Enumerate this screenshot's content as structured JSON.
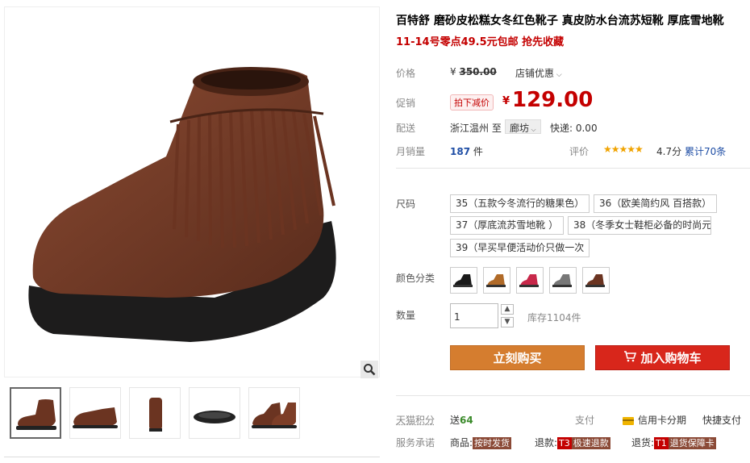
{
  "product": {
    "title": "百特舒 磨砂皮松糕女冬红色靴子 真皮防水台流苏短靴 厚底雪地靴",
    "promo": "11-14号零点49.5元包邮 抢先收藏"
  },
  "price": {
    "label": "价格",
    "currency": "¥",
    "original": "350.00",
    "store_discount": "店铺优惠"
  },
  "promotion": {
    "label": "促销",
    "tag": "拍下减价",
    "currency": "¥",
    "price": "129.00"
  },
  "shipping": {
    "label": "配送",
    "from": "浙江温州",
    "to_word": "至",
    "to": "廊坊",
    "fee": "快递: 0.00"
  },
  "sales": {
    "label": "月销量",
    "count": "187",
    "unit": "件",
    "rating_label": "评价",
    "stars": "★★★★★",
    "score": "4.7分",
    "reviews": "累计70条"
  },
  "size": {
    "label": "尺码",
    "options": [
      "35（五款今冬流行的糖果色）",
      "36（欧美简约风 百搭款）",
      "37（厚底流苏雪地靴 ）",
      "38（冬季女士鞋柜必备的时尚元",
      "39（早买早便活动价只做一次"
    ]
  },
  "color": {
    "label": "颜色分类"
  },
  "quantity": {
    "label": "数量",
    "value": "1",
    "up": "▲",
    "down": "▼",
    "stock": "库存1104件"
  },
  "actions": {
    "buy": "立刻购买",
    "cart": "加入购物车"
  },
  "points": {
    "label": "天猫积分",
    "send": "送",
    "value": "64",
    "pay": "支付",
    "credit": "信用卡分期",
    "fast_pay": "快捷支付"
  },
  "service": {
    "label": "服务承诺",
    "goods": "商品:",
    "goods_badge": "按时发货",
    "refund": "退款:",
    "refund_t": "T3",
    "refund_badge": "极速退款",
    "return": "退货:",
    "return_t": "T1",
    "return_badge": "退货保障卡"
  },
  "colors": {
    "price_red": "#c40000",
    "buy_orange": "#d57d2f",
    "cart_red": "#d8261b",
    "link_blue": "#1f4ea5"
  }
}
